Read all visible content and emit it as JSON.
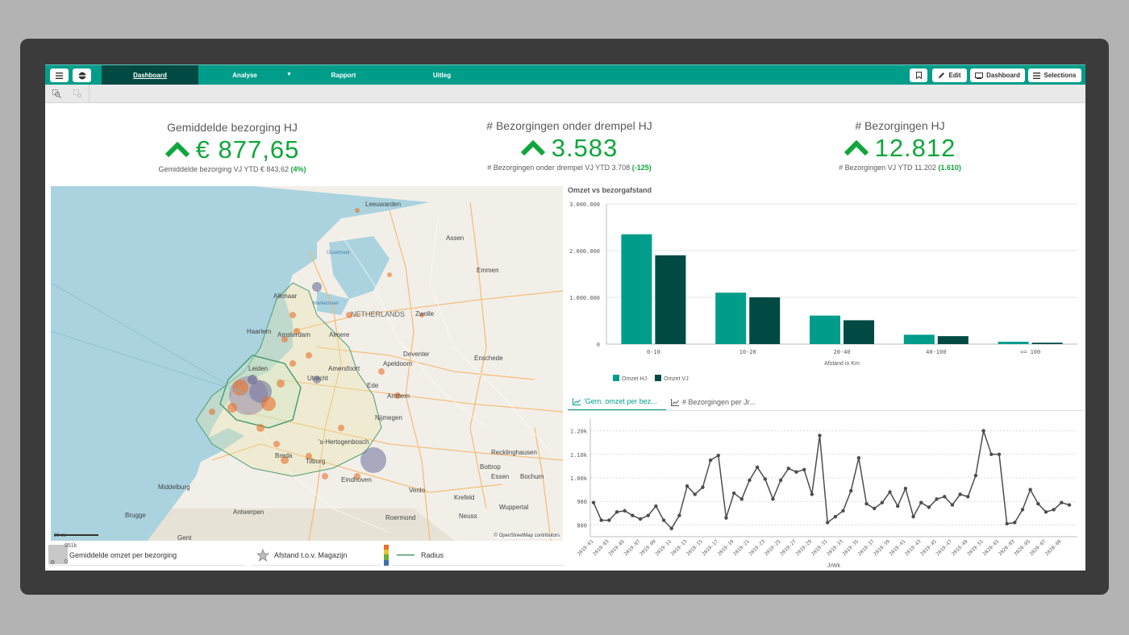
{
  "nav": {
    "tabs": [
      {
        "label": "Dashboard"
      },
      {
        "label": "Analyse"
      },
      {
        "label": "Rapport"
      },
      {
        "label": "Uitleg"
      }
    ],
    "bookmark_icon": "bookmark-icon",
    "edit_label": "Edit",
    "dashboard_label": "Dashboard",
    "selections_label": "Selections"
  },
  "kpis": [
    {
      "title": "Gemiddelde bezorging HJ",
      "value": "€ 877,65",
      "sub": "Gemiddelde bezorging VJ YTD € 843,62",
      "delta": "(4%)",
      "color": "#10a63b"
    },
    {
      "title": "# Bezorgingen onder drempel HJ",
      "value": "3.583",
      "sub": "# Bezorgingen onder drempel VJ YTD 3.708",
      "delta": "(-125)",
      "color": "#10a63b"
    },
    {
      "title": "# Bezorgingen HJ",
      "value": "12.812",
      "sub": "# Bezorgingen VJ YTD 11.202",
      "delta": "(1.610)",
      "color": "#10a63b"
    }
  ],
  "map": {
    "labels": [
      "Leeuwarden",
      "Assen",
      "Emmen",
      "IJsselmeer",
      "Markermeer",
      "Alkmaar",
      "NETHERLANDS",
      "Zwolle",
      "Haarlem",
      "Amsterdam",
      "Almere",
      "Leiden",
      "Deventer",
      "Enschede",
      "Utrecht",
      "Amersfoort",
      "Apeldoorn",
      "Ede",
      "Arnhem",
      "Nijmegen",
      "'s-Hertogenbosch",
      "Breda",
      "Tilburg",
      "Middelburg",
      "Eindhoven",
      "Recklinghausen",
      "Bottrop",
      "Essen",
      "Bochum",
      "Venlo",
      "Krefeld",
      "Neuss",
      "Wuppertal",
      "Brugge",
      "Antwerpen",
      "Roermond",
      "Gent"
    ],
    "scale": "20 mi",
    "attribution": "© OpenStreetMap contributors"
  },
  "legend": {
    "size_max": "951k",
    "size_min": "0",
    "item1": "Gemiddelde omzet per bezorging",
    "item2": "Afstand t.o.v. Magazijn",
    "item3": "Radius"
  },
  "bar_title": "Omzet vs bezorgafstand",
  "line_tabs": {
    "tab1": "'Gem. omzet per bez...",
    "tab2": "# Bezorgingen per Jr..."
  },
  "chart_data": [
    {
      "type": "bar",
      "title": "Omzet vs bezorgafstand",
      "xlabel": "Afstand in Km",
      "ylabel": "",
      "categories": [
        "0-10",
        "10-20",
        "20-40",
        "40-100",
        ">= 100"
      ],
      "series": [
        {
          "name": "Omzet HJ",
          "values": [
            2350000,
            1100000,
            610000,
            200000,
            50000
          ],
          "color": "#009d8a"
        },
        {
          "name": "Omzet VJ",
          "values": [
            1900000,
            1000000,
            510000,
            170000,
            30000
          ],
          "color": "#004a43"
        }
      ],
      "ylim": [
        0,
        3000000
      ],
      "yticks": [
        "0",
        "1.000.000",
        "2.000.000",
        "3.000.000"
      ],
      "grid": true,
      "legend": "bottom-left"
    },
    {
      "type": "line",
      "title": "",
      "xlabel": "JrWk",
      "ylabel": "",
      "x": [
        "2019-01",
        "2019-02",
        "2019-03",
        "2019-04",
        "2019-05",
        "2019-06",
        "2019-07",
        "2019-08",
        "2019-09",
        "2019-10",
        "2019-11",
        "2019-12",
        "2019-13",
        "2019-14",
        "2019-15",
        "2019-16",
        "2019-17",
        "2019-18",
        "2019-19",
        "2019-20",
        "2019-21",
        "2019-22",
        "2019-23",
        "2019-24",
        "2019-25",
        "2019-26",
        "2019-27",
        "2019-28",
        "2019-29",
        "2019-30",
        "2019-31",
        "2019-32",
        "2019-33",
        "2019-34",
        "2019-35",
        "2019-36",
        "2019-37",
        "2019-38",
        "2019-39",
        "2019-40",
        "2019-41",
        "2019-42",
        "2019-43",
        "2019-44",
        "2019-45",
        "2019-46",
        "2019-47",
        "2019-48",
        "2019-49",
        "2019-50",
        "2019-51",
        "2019-52",
        "2020-01",
        "2020-02",
        "2020-03",
        "2020-04",
        "2020-05",
        "2020-06",
        "2020-07",
        "2020-08",
        "2020-09",
        "2020-10"
      ],
      "xtick_labels": [
        "2019-01",
        "2019-03",
        "2019-05",
        "2019-07",
        "2019-09",
        "2019-11",
        "2019-13",
        "2019-15",
        "2019-17",
        "2019-19",
        "2019-21",
        "2019-23",
        "2019-25",
        "2019-27",
        "2019-29",
        "2019-31",
        "2019-33",
        "2019-35",
        "2019-37",
        "2019-39",
        "2019-41",
        "2019-43",
        "2019-45",
        "2019-47",
        "2019-49",
        "2019-51",
        "2020-01",
        "2020-03",
        "2020-05",
        "2020-07",
        "2020-09"
      ],
      "values": [
        895,
        820,
        820,
        855,
        860,
        840,
        825,
        840,
        880,
        820,
        785,
        840,
        965,
        930,
        960,
        1075,
        1095,
        830,
        935,
        910,
        990,
        1045,
        995,
        910,
        990,
        1040,
        1025,
        1035,
        930,
        1180,
        810,
        835,
        860,
        945,
        1085,
        890,
        870,
        895,
        940,
        880,
        955,
        835,
        895,
        875,
        910,
        920,
        885,
        930,
        920,
        1010,
        1200,
        1100,
        1100,
        805,
        810,
        865,
        950,
        890,
        855,
        865,
        895,
        885
      ],
      "ylim": [
        750,
        1250
      ],
      "yticks": [
        "800",
        "900",
        "1.00k",
        "1.10k",
        "1.20k"
      ],
      "grid": true,
      "color": "#4d4d4d"
    }
  ]
}
